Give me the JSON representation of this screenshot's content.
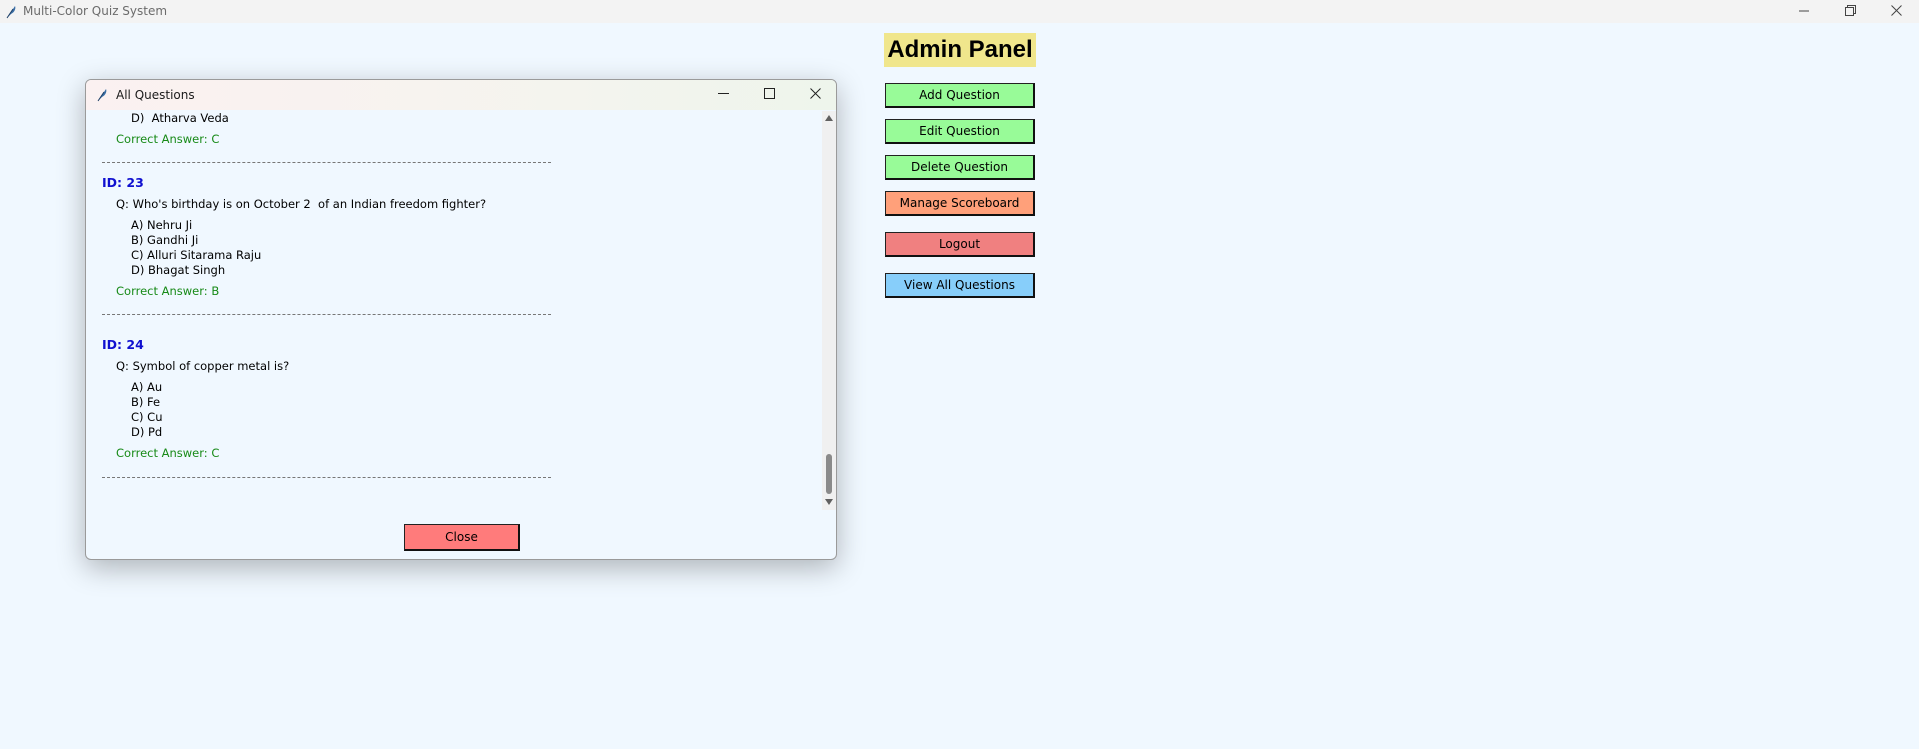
{
  "window": {
    "title": "Multi-Color Quiz System"
  },
  "admin": {
    "title": "Admin Panel",
    "buttons": [
      {
        "label": "Add Question",
        "color": "#98fb98"
      },
      {
        "label": "Edit Question",
        "color": "#98fb98"
      },
      {
        "label": "Delete Question",
        "color": "#98fb98"
      },
      {
        "label": "Manage Scoreboard",
        "color": "#ffa07a"
      },
      {
        "label": "Logout",
        "color": "#f08080"
      },
      {
        "label": "View All Questions",
        "color": "#87cefa"
      }
    ]
  },
  "dialog": {
    "title": "All Questions",
    "close_label": "Close",
    "partial": {
      "option_d": "D)  Atharva Veda",
      "answer": "Correct Answer: C"
    },
    "questions": [
      {
        "id": "ID: 23",
        "question": "Q: Who's birthday is on October 2  of an Indian freedom fighter?",
        "options": [
          "A) Nehru Ji",
          "B) Gandhi Ji",
          "C) Alluri Sitarama Raju",
          "D) Bhagat Singh"
        ],
        "answer": "Correct Answer: B"
      },
      {
        "id": "ID: 24",
        "question": "Q: Symbol of copper metal is?",
        "options": [
          "A) Au",
          "B) Fe",
          "C) Cu",
          "D) Pd"
        ],
        "answer": "Correct Answer: C"
      }
    ]
  },
  "icons": {
    "app": "feather-icon",
    "minimize": "minimize-icon",
    "maximize": "maximize-icon",
    "restore": "restore-icon",
    "close": "close-icon"
  }
}
